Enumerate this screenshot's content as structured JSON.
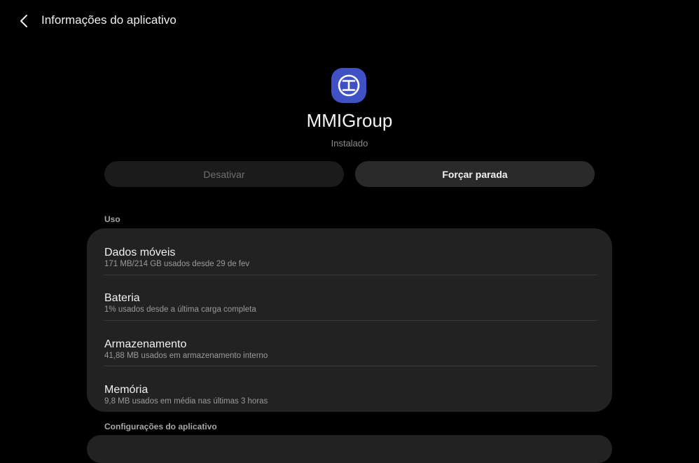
{
  "header": {
    "title": "Informações do aplicativo",
    "back_icon": "chevron-left-icon"
  },
  "app": {
    "name": "MMIGroup",
    "status": "Instalado",
    "icon": "mmigroup-app-icon",
    "icon_color": "#3f51c4"
  },
  "actions": {
    "disable_label": "Desativar",
    "force_stop_label": "Forçar parada"
  },
  "usage": {
    "section_label": "Uso",
    "items": [
      {
        "title": "Dados móveis",
        "subtitle": "171 MB/214 GB usados desde 29 de fev"
      },
      {
        "title": "Bateria",
        "subtitle": "1% usados desde a última carga completa"
      },
      {
        "title": "Armazenamento",
        "subtitle": "41,88 MB usados em armazenamento interno"
      },
      {
        "title": "Memória",
        "subtitle": "9,8 MB usados em média nas últimas 3 horas"
      }
    ]
  },
  "settings": {
    "section_label": "Configurações do aplicativo"
  },
  "colors": {
    "background": "#000000",
    "card": "#222222",
    "accent": "#3f51c4"
  }
}
